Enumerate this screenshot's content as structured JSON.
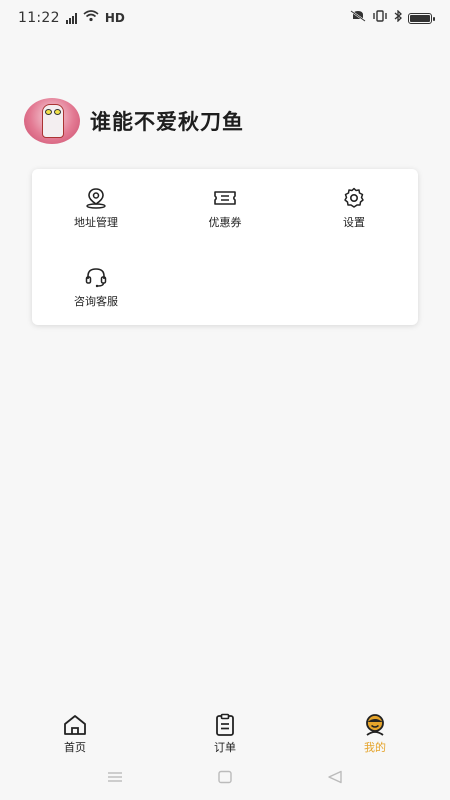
{
  "status_bar": {
    "time": "11:22",
    "network": "HD"
  },
  "profile": {
    "username": "谁能不爱秋刀鱼"
  },
  "menu": {
    "items": [
      {
        "label": "地址管理",
        "icon": "location-icon"
      },
      {
        "label": "优惠券",
        "icon": "coupon-icon"
      },
      {
        "label": "设置",
        "icon": "settings-icon"
      },
      {
        "label": "咨询客服",
        "icon": "headset-icon"
      }
    ]
  },
  "tabs": [
    {
      "label": "首页",
      "icon": "home-icon"
    },
    {
      "label": "订单",
      "icon": "clipboard-icon"
    },
    {
      "label": "我的",
      "icon": "profile-icon"
    }
  ],
  "colors": {
    "accent": "#e5a42b",
    "background": "#f7f7f7",
    "card": "#ffffff"
  }
}
